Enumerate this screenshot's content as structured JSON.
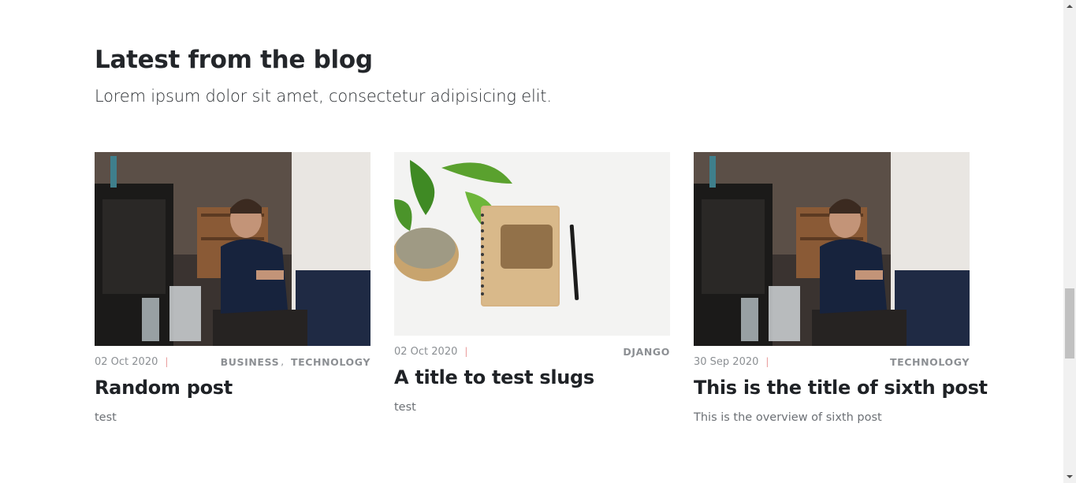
{
  "section": {
    "title": "Latest from the blog",
    "subtitle": "Lorem ipsum dolor sit amet, consectetur adipisicing elit."
  },
  "posts": [
    {
      "image": "barista-photo",
      "date": "02 Oct 2020",
      "separator": "|",
      "categories": [
        "BUSINESS",
        "TECHNOLOGY"
      ],
      "category_comma": ",",
      "title": "Random post",
      "excerpt": "test"
    },
    {
      "image": "notebook-plant-photo",
      "date": "02 Oct 2020",
      "separator": "|",
      "categories": [
        "DJANGO"
      ],
      "title": "A title to test slugs",
      "excerpt": "test"
    },
    {
      "image": "barista-photo",
      "date": "30 Sep 2020",
      "separator": "|",
      "categories": [
        "TECHNOLOGY"
      ],
      "title": "This is the title of sixth post",
      "excerpt": "This is the overview of sixth post"
    }
  ],
  "colors": {
    "title": "#1f2226",
    "meta": "#8b8f93",
    "separator": "#e99a9a",
    "excerpt": "#6c7075"
  }
}
